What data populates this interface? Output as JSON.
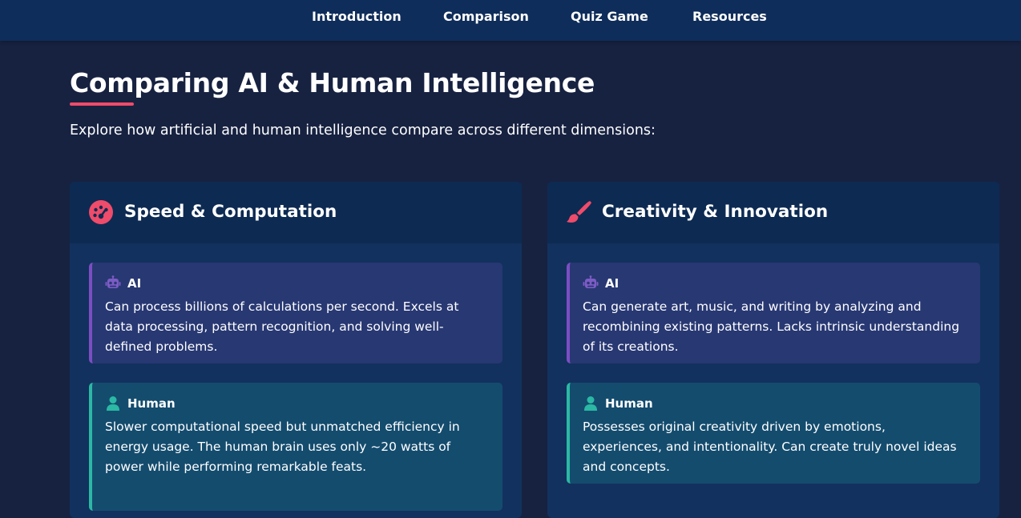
{
  "nav": {
    "items": [
      {
        "label": "Introduction"
      },
      {
        "label": "Comparison"
      },
      {
        "label": "Quiz Game"
      },
      {
        "label": "Resources"
      }
    ]
  },
  "main": {
    "title": "Comparing AI & Human Intelligence",
    "intro": "Explore how artificial and human intelligence compare across different dimensions:"
  },
  "cards": [
    {
      "title": "Speed & Computation",
      "icon": "gauge-icon",
      "ai": {
        "label": "AI",
        "text": "Can process billions of calculations per second. Excels at data processing, pattern recognition, and solving well-defined problems."
      },
      "human": {
        "label": "Human",
        "text": "Slower computational speed but unmatched efficiency in energy usage. The human brain uses only ~20 watts of power while performing remarkable feats."
      }
    },
    {
      "title": "Creativity & Innovation",
      "icon": "paintbrush-icon",
      "ai": {
        "label": "AI",
        "text": "Can generate art, music, and writing by analyzing and recombining existing patterns. Lacks intrinsic understanding of its creations."
      },
      "human": {
        "label": "Human",
        "text": "Possesses original creativity driven by emotions, experiences, and intentionality. Can create truly novel ideas and concepts."
      }
    }
  ],
  "colors": {
    "page_bg": "#172241",
    "nav_bg": "#0f2d5a",
    "accent": "#ef4b6a",
    "ai_accent": "#7c4ec2",
    "human_accent": "#2bb8a4"
  }
}
